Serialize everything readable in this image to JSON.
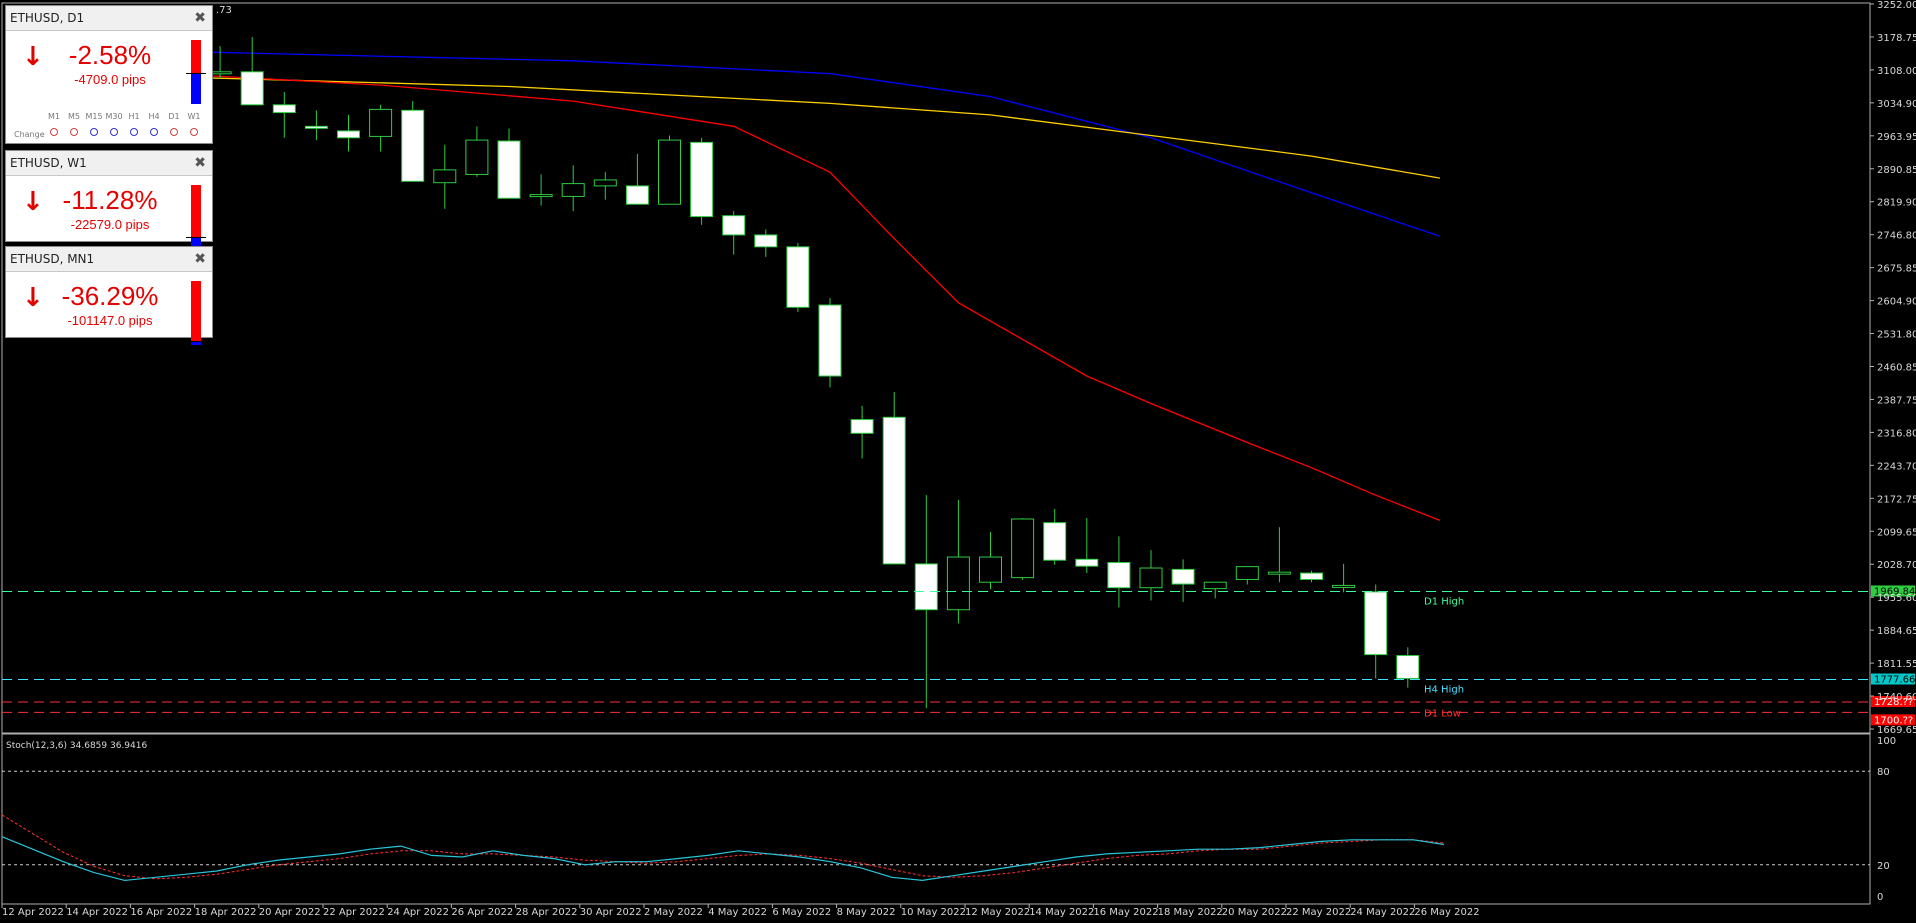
{
  "chart": {
    "symbol_fragment": ".73",
    "price_axis": [
      "3252.00",
      "3178.75",
      "3108.00",
      "3034.90",
      "2963.95",
      "2890.85",
      "2819.90",
      "2746.80",
      "2675.85",
      "2604.90",
      "2531.80",
      "2460.85",
      "2387.75",
      "2316.80",
      "2243.70",
      "2172.75",
      "2099.65",
      "2028.70",
      "1955.60",
      "1884.65",
      "1811.55",
      "1740.60",
      "1669.65"
    ],
    "date_axis": [
      "12 Apr 2022",
      "14 Apr 2022",
      "16 Apr 2022",
      "18 Apr 2022",
      "20 Apr 2022",
      "22 Apr 2022",
      "24 Apr 2022",
      "26 Apr 2022",
      "28 Apr 2022",
      "30 Apr 2022",
      "2 May 2022",
      "4 May 2022",
      "6 May 2022",
      "8 May 2022",
      "10 May 2022",
      "12 May 2022",
      "14 May 2022",
      "16 May 2022",
      "18 May 2022",
      "20 May 2022",
      "22 May 2022",
      "24 May 2022",
      "26 May 2022"
    ],
    "levels": [
      {
        "label": "D1 High",
        "price_tag": "1969.84",
        "value": 1969.84,
        "color": "#3cff9c",
        "tag_bg": "#2ecc40",
        "tag_fg": "#000000"
      },
      {
        "label": "H4 High",
        "price_tag": "1777.66",
        "value": 1777.66,
        "color": "#46e0ff",
        "tag_bg": "#00c8c8",
        "tag_fg": "#000000"
      },
      {
        "label": "",
        "price_tag": "1728.??",
        "value": 1728.5,
        "color": "#ff3030",
        "tag_bg": "#ff0000",
        "tag_fg": "#ffffff"
      },
      {
        "label": "D1 Low",
        "price_tag": "1700.??",
        "value": 1706,
        "color": "#ff3030",
        "tag_bg": "#ff0000",
        "tag_fg": "#ffffff"
      }
    ],
    "moving_averages": [
      {
        "color": "#0000ff",
        "points": [
          [
            0,
            3148
          ],
          [
            12,
            3128
          ],
          [
            20,
            3100
          ],
          [
            25,
            3050
          ],
          [
            30,
            2960
          ],
          [
            35,
            2840
          ],
          [
            39,
            2745
          ]
        ]
      },
      {
        "color": "#ffd000",
        "points": [
          [
            0,
            3092
          ],
          [
            10,
            3072
          ],
          [
            20,
            3035
          ],
          [
            25,
            3010
          ],
          [
            30,
            2965
          ],
          [
            35,
            2920
          ],
          [
            39,
            2872
          ]
        ]
      },
      {
        "color": "#ff0000",
        "points": [
          [
            0,
            3098
          ],
          [
            6,
            3075
          ],
          [
            12,
            3040
          ],
          [
            17,
            2985
          ],
          [
            20,
            2885
          ],
          [
            22,
            2740
          ],
          [
            24,
            2600
          ],
          [
            26,
            2520
          ],
          [
            28,
            2440
          ],
          [
            30,
            2380
          ],
          [
            33,
            2295
          ],
          [
            35,
            2240
          ],
          [
            37,
            2180
          ],
          [
            39,
            2125
          ]
        ]
      }
    ],
    "candles": [
      {
        "o": 3095,
        "h": 3140,
        "l": 3035,
        "c": 3038
      },
      {
        "o": 3100,
        "h": 3160,
        "l": 3090,
        "c": 3104
      },
      {
        "o": 3104,
        "h": 3180,
        "l": 3050,
        "c": 3032
      },
      {
        "o": 3032,
        "h": 3060,
        "l": 2960,
        "c": 3015
      },
      {
        "o": 2985,
        "h": 3020,
        "l": 2955,
        "c": 2982
      },
      {
        "o": 2975,
        "h": 3010,
        "l": 2930,
        "c": 2960
      },
      {
        "o": 2963,
        "h": 3032,
        "l": 2930,
        "c": 3022
      },
      {
        "o": 3020,
        "h": 3040,
        "l": 2880,
        "c": 2865
      },
      {
        "o": 2862,
        "h": 2945,
        "l": 2805,
        "c": 2890
      },
      {
        "o": 2880,
        "h": 2985,
        "l": 2875,
        "c": 2955
      },
      {
        "o": 2953,
        "h": 2980,
        "l": 2840,
        "c": 2828
      },
      {
        "o": 2832,
        "h": 2880,
        "l": 2812,
        "c": 2836
      },
      {
        "o": 2832,
        "h": 2900,
        "l": 2800,
        "c": 2860
      },
      {
        "o": 2855,
        "h": 2885,
        "l": 2825,
        "c": 2868
      },
      {
        "o": 2855,
        "h": 2925,
        "l": 2815,
        "c": 2815
      },
      {
        "o": 2815,
        "h": 2965,
        "l": 2815,
        "c": 2955
      },
      {
        "o": 2950,
        "h": 2960,
        "l": 2770,
        "c": 2788
      },
      {
        "o": 2790,
        "h": 2800,
        "l": 2705,
        "c": 2748
      },
      {
        "o": 2748,
        "h": 2760,
        "l": 2700,
        "c": 2722
      },
      {
        "o": 2722,
        "h": 2730,
        "l": 2580,
        "c": 2590
      },
      {
        "o": 2595,
        "h": 2610,
        "l": 2415,
        "c": 2440
      },
      {
        "o": 2345,
        "h": 2375,
        "l": 2260,
        "c": 2315
      },
      {
        "o": 2350,
        "h": 2405,
        "l": 2200,
        "c": 2030
      },
      {
        "o": 2030,
        "h": 2180,
        "l": 1715,
        "c": 1930
      },
      {
        "o": 1930,
        "h": 2170,
        "l": 1900,
        "c": 2045
      },
      {
        "o": 1990,
        "h": 2100,
        "l": 1975,
        "c": 2045
      },
      {
        "o": 2000,
        "h": 2130,
        "l": 1995,
        "c": 2128
      },
      {
        "o": 2120,
        "h": 2150,
        "l": 2028,
        "c": 2038
      },
      {
        "o": 2040,
        "h": 2130,
        "l": 2010,
        "c": 2025
      },
      {
        "o": 2033,
        "h": 2090,
        "l": 1935,
        "c": 1978
      },
      {
        "o": 1978,
        "h": 2060,
        "l": 1950,
        "c": 2021
      },
      {
        "o": 2018,
        "h": 2040,
        "l": 1947,
        "c": 1986
      },
      {
        "o": 1976,
        "h": 1990,
        "l": 1955,
        "c": 1990
      },
      {
        "o": 1996,
        "h": 2020,
        "l": 1985,
        "c": 2024
      },
      {
        "o": 2010,
        "h": 2110,
        "l": 1990,
        "c": 2012
      },
      {
        "o": 2010,
        "h": 2015,
        "l": 1990,
        "c": 1996
      },
      {
        "o": 1979,
        "h": 2030,
        "l": 1968,
        "c": 1983
      },
      {
        "o": 1969,
        "h": 1985,
        "l": 1780,
        "c": 1832
      },
      {
        "o": 1830,
        "h": 1848,
        "l": 1760,
        "c": 1780
      }
    ]
  },
  "stochastic": {
    "label": "Stoch(12,3,6) 34.6859 36.9416",
    "axis": [
      "100",
      "80",
      "20",
      "0"
    ],
    "main_color": "#26c6da",
    "signal_color": "#ff3030",
    "main": [
      38,
      30,
      22,
      15,
      10,
      12,
      14,
      16,
      20,
      23,
      25,
      27,
      30,
      32,
      26,
      25,
      29,
      26,
      24,
      20,
      22,
      22,
      24,
      26,
      29,
      27,
      25,
      22,
      18,
      12,
      10,
      13,
      16,
      19,
      22,
      25,
      27,
      28,
      29,
      30,
      30,
      31,
      33,
      35,
      36,
      36,
      36,
      33
    ],
    "signal": [
      52,
      40,
      28,
      19,
      13,
      11,
      12,
      14,
      17,
      20,
      22,
      24,
      27,
      29,
      29,
      27,
      27,
      26,
      25,
      23,
      22,
      21,
      22,
      24,
      26,
      27,
      26,
      24,
      21,
      17,
      13,
      12,
      13,
      15,
      18,
      21,
      24,
      26,
      27,
      29,
      30,
      30,
      32,
      34,
      35,
      36,
      36,
      34
    ]
  },
  "widgets": [
    {
      "title": "ETHUSD, D1",
      "percent": "-2.58%",
      "pips": "-4709.0 pips",
      "arrow": "↓",
      "red_frac": 0.52,
      "blue_frac": 0.48,
      "timeframes": [
        "M1",
        "M5",
        "M15",
        "M30",
        "H1",
        "H4",
        "D1",
        "W1"
      ],
      "change_label": "Change"
    },
    {
      "title": "ETHUSD, W1",
      "percent": "-11.28%",
      "pips": "-22579.0 pips",
      "arrow": "↓",
      "red_frac": 0.82,
      "blue_frac": 0.18
    },
    {
      "title": "ETHUSD, MN1",
      "percent": "-36.29%",
      "pips": "-101147.0 pips",
      "arrow": "↓",
      "red_frac": 0.93,
      "blue_frac": 0.07
    }
  ]
}
